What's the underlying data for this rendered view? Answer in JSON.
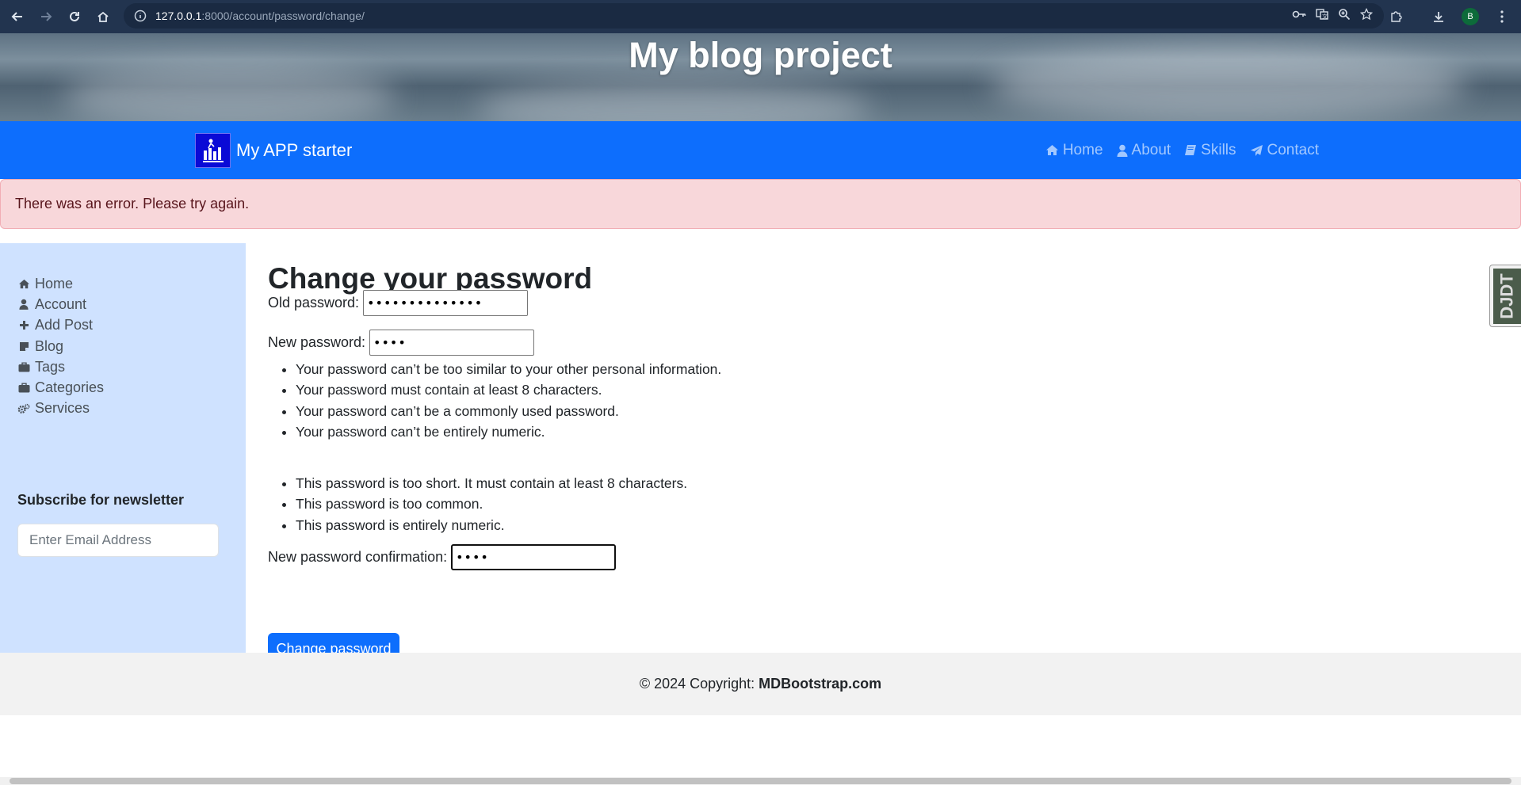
{
  "browser": {
    "url_host": "127.0.0.1",
    "url_rest": ":8000/account/password/change/",
    "profile_initial": "B",
    "back_icon": "arrow-left-icon",
    "forward_icon": "arrow-right-icon",
    "reload_icon": "reload-icon",
    "home_icon": "home-icon"
  },
  "hero": {
    "title": "My blog project"
  },
  "navbar": {
    "brand": "My APP starter",
    "links": [
      {
        "label": "Home",
        "icon": "home-icon"
      },
      {
        "label": "About",
        "icon": "user-icon"
      },
      {
        "label": "Skills",
        "icon": "book-icon"
      },
      {
        "label": "Contact",
        "icon": "paper-plane-icon"
      }
    ]
  },
  "alert": {
    "message": "There was an error. Please try again."
  },
  "sidebar": {
    "items": [
      {
        "label": "Home",
        "icon": "home-icon"
      },
      {
        "label": "Account",
        "icon": "user-icon"
      },
      {
        "label": "Add Post",
        "icon": "plus-icon"
      },
      {
        "label": "Blog",
        "icon": "sticky-note-icon"
      },
      {
        "label": "Tags",
        "icon": "briefcase-icon"
      },
      {
        "label": "Categories",
        "icon": "briefcase-icon"
      },
      {
        "label": "Services",
        "icon": "cogs-icon"
      }
    ],
    "newsletter_title": "Subscribe for newsletter",
    "newsletter_placeholder": "Enter Email Address"
  },
  "form": {
    "title": "Change your password",
    "old_label": "Old password:",
    "old_value": "••••••••••••••",
    "new_label": "New password:",
    "new_value": "••••",
    "help": [
      "Your password can’t be too similar to your other personal information.",
      "Your password must contain at least 8 characters.",
      "Your password can’t be a commonly used password.",
      "Your password can’t be entirely numeric."
    ],
    "errors": [
      "This password is too short. It must contain at least 8 characters.",
      "This password is too common.",
      "This password is entirely numeric."
    ],
    "confirm_label": "New password confirmation:",
    "confirm_value": "••••",
    "submit": "Change password"
  },
  "debug_toolbar": {
    "label": "DJDT"
  },
  "footer": {
    "text": "© 2024 Copyright:",
    "link": "MDBootstrap.com"
  },
  "colors": {
    "primary": "#0d6efd",
    "alert_bg": "#f8d7da",
    "sidebar_bg": "#cfe2ff"
  }
}
